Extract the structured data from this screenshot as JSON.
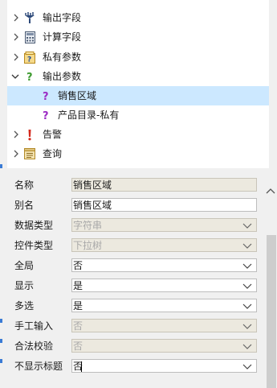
{
  "tree": {
    "nodes": [
      {
        "label": "输出字段",
        "icon": "output-field-icon",
        "expanded": false
      },
      {
        "label": "计算字段",
        "icon": "calc-field-icon",
        "expanded": false
      },
      {
        "label": "私有参数",
        "icon": "private-param-icon",
        "expanded": false
      },
      {
        "label": "输出参数",
        "icon": "output-param-icon",
        "expanded": true
      },
      {
        "label": "销售区域",
        "icon": "param-question-icon",
        "selected": true
      },
      {
        "label": "产品目录-私有",
        "icon": "param-question-icon"
      },
      {
        "label": "告警",
        "icon": "alert-icon",
        "expanded": false
      },
      {
        "label": "查询",
        "icon": "query-icon",
        "expanded": false
      }
    ]
  },
  "properties": {
    "rows": [
      {
        "label": "名称",
        "value": "销售区域",
        "state": "readonly",
        "dropdown": false
      },
      {
        "label": "别名",
        "value": "销售区域",
        "state": "editable",
        "dropdown": false
      },
      {
        "label": "数据类型",
        "value": "字符串",
        "state": "disabled",
        "dropdown": true
      },
      {
        "label": "控件类型",
        "value": "下拉树",
        "state": "disabled",
        "dropdown": true
      },
      {
        "label": "全局",
        "value": "否",
        "state": "editable",
        "dropdown": true
      },
      {
        "label": "显示",
        "value": "是",
        "state": "editable",
        "dropdown": true
      },
      {
        "label": "多选",
        "value": "是",
        "state": "editable",
        "dropdown": true
      },
      {
        "label": "手工输入",
        "value": "否",
        "state": "disabled",
        "dropdown": true
      },
      {
        "label": "合法校验",
        "value": "否",
        "state": "disabled",
        "dropdown": true
      },
      {
        "label": "不显示标题",
        "value": "否",
        "state": "editable",
        "dropdown": true
      }
    ]
  },
  "colors": {
    "selected_row": "#cce8ff",
    "question_icon": "#9b2bc4",
    "alert_icon": "#d42a1e",
    "output_param_icon": "#3c9a2e"
  }
}
